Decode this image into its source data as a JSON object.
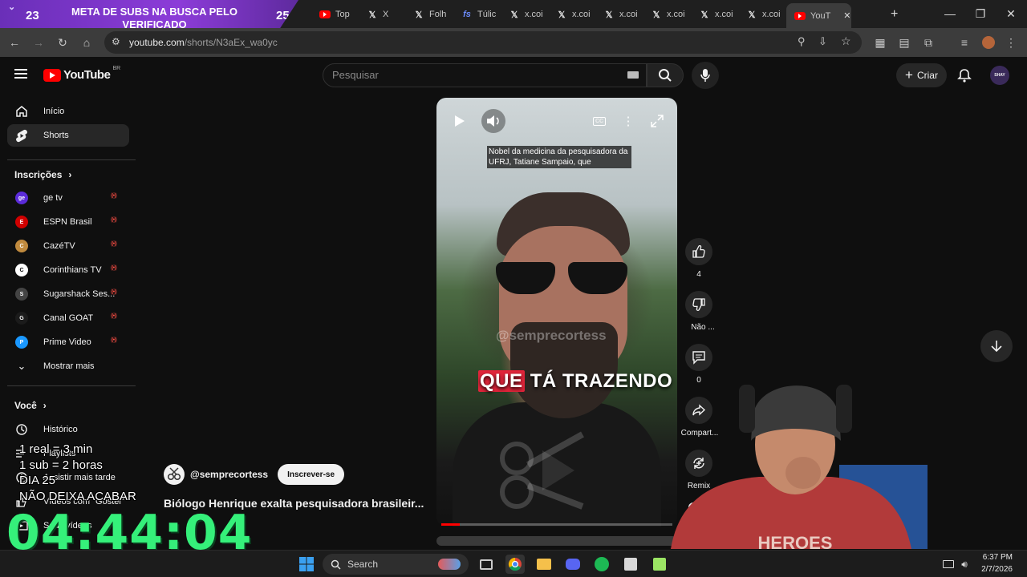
{
  "browser": {
    "tabs": [
      {
        "title": "Top",
        "icon": "youtube-icon"
      },
      {
        "title": "X",
        "icon": "x-icon"
      },
      {
        "title": "Folh",
        "icon": "x-icon"
      },
      {
        "title": "Túlic",
        "icon": "fs-icon"
      },
      {
        "title": "x.coi",
        "icon": "x-icon"
      },
      {
        "title": "x.coi",
        "icon": "x-icon"
      },
      {
        "title": "x.coi",
        "icon": "x-icon"
      },
      {
        "title": "x.coi",
        "icon": "x-icon"
      },
      {
        "title": "x.coi",
        "icon": "x-icon"
      },
      {
        "title": "x.coi",
        "icon": "x-icon"
      },
      {
        "title": "YouT",
        "icon": "youtube-icon"
      }
    ],
    "url_host": "youtube.com",
    "url_path": "/shorts/N3aEx_wa0yc"
  },
  "banner": {
    "left_number": "23",
    "text": "META DE SUBS NA BUSCA PELO VERIFICADO",
    "right_number": "25"
  },
  "youtube": {
    "logo_text": "YouTube",
    "region": "BR",
    "search_placeholder": "Pesquisar",
    "create_label": "Criar"
  },
  "sidebar": {
    "primary": [
      {
        "label": "Início",
        "icon": "home-icon"
      },
      {
        "label": "Shorts",
        "icon": "shorts-icon"
      }
    ],
    "subscriptions_heading": "Inscrições",
    "channels": [
      {
        "name": "ge tv",
        "color": "#5b2bd9",
        "abbr": "ge"
      },
      {
        "name": "ESPN Brasil",
        "color": "#d00000",
        "abbr": "E"
      },
      {
        "name": "CazéTV",
        "color": "#c08a3e",
        "abbr": "C"
      },
      {
        "name": "Corinthians TV",
        "color": "#ffffff",
        "abbr": "C"
      },
      {
        "name": "Sugarshack Ses...",
        "color": "#444444",
        "abbr": "S"
      },
      {
        "name": "Canal GOAT",
        "color": "#1b1b1b",
        "abbr": "G"
      },
      {
        "name": "Prime Video",
        "color": "#1a98ff",
        "abbr": "P"
      }
    ],
    "show_more": "Mostrar mais",
    "you_heading": "Você",
    "you_items": [
      {
        "label": "Histórico",
        "icon": "history-icon"
      },
      {
        "label": "Playlists",
        "icon": "playlist-icon"
      },
      {
        "label": "Assistir mais tarde",
        "icon": "watch-later-icon"
      },
      {
        "label": "Vídeos com \"Gostei\"",
        "icon": "like-icon"
      },
      {
        "label": "Seus vídeos",
        "icon": "your-videos-icon"
      }
    ]
  },
  "video": {
    "caption_top": "Nobel da medicina da pesquisadora da UFRJ, Tatiane Sampaio, que",
    "caption_big_highlight": "QUE",
    "caption_big_rest": "TÁ TRAZENDO",
    "watermark": "@semprecortess",
    "cc_label": "CC",
    "progress": 0.08
  },
  "actions": {
    "likes": "4",
    "dislike_label": "Não ...",
    "comments": "0",
    "share_label": "Compart...",
    "remix_label": "Remix"
  },
  "channel": {
    "handle": "@semprecortess",
    "subscribe_label": "Inscrever-se",
    "video_title": "Biólogo Henrique exalta pesquisadora brasileir..."
  },
  "overlay": {
    "line1": "1 real = 3 min",
    "line2": "1 sub = 2 horas",
    "line3": "DIA 25",
    "line4": "NÃO DEIXA ACABAR",
    "timer": "04:44:04"
  },
  "taskbar": {
    "search_label": "Search",
    "time": "6:37 PM",
    "date": "2/7/2026"
  }
}
